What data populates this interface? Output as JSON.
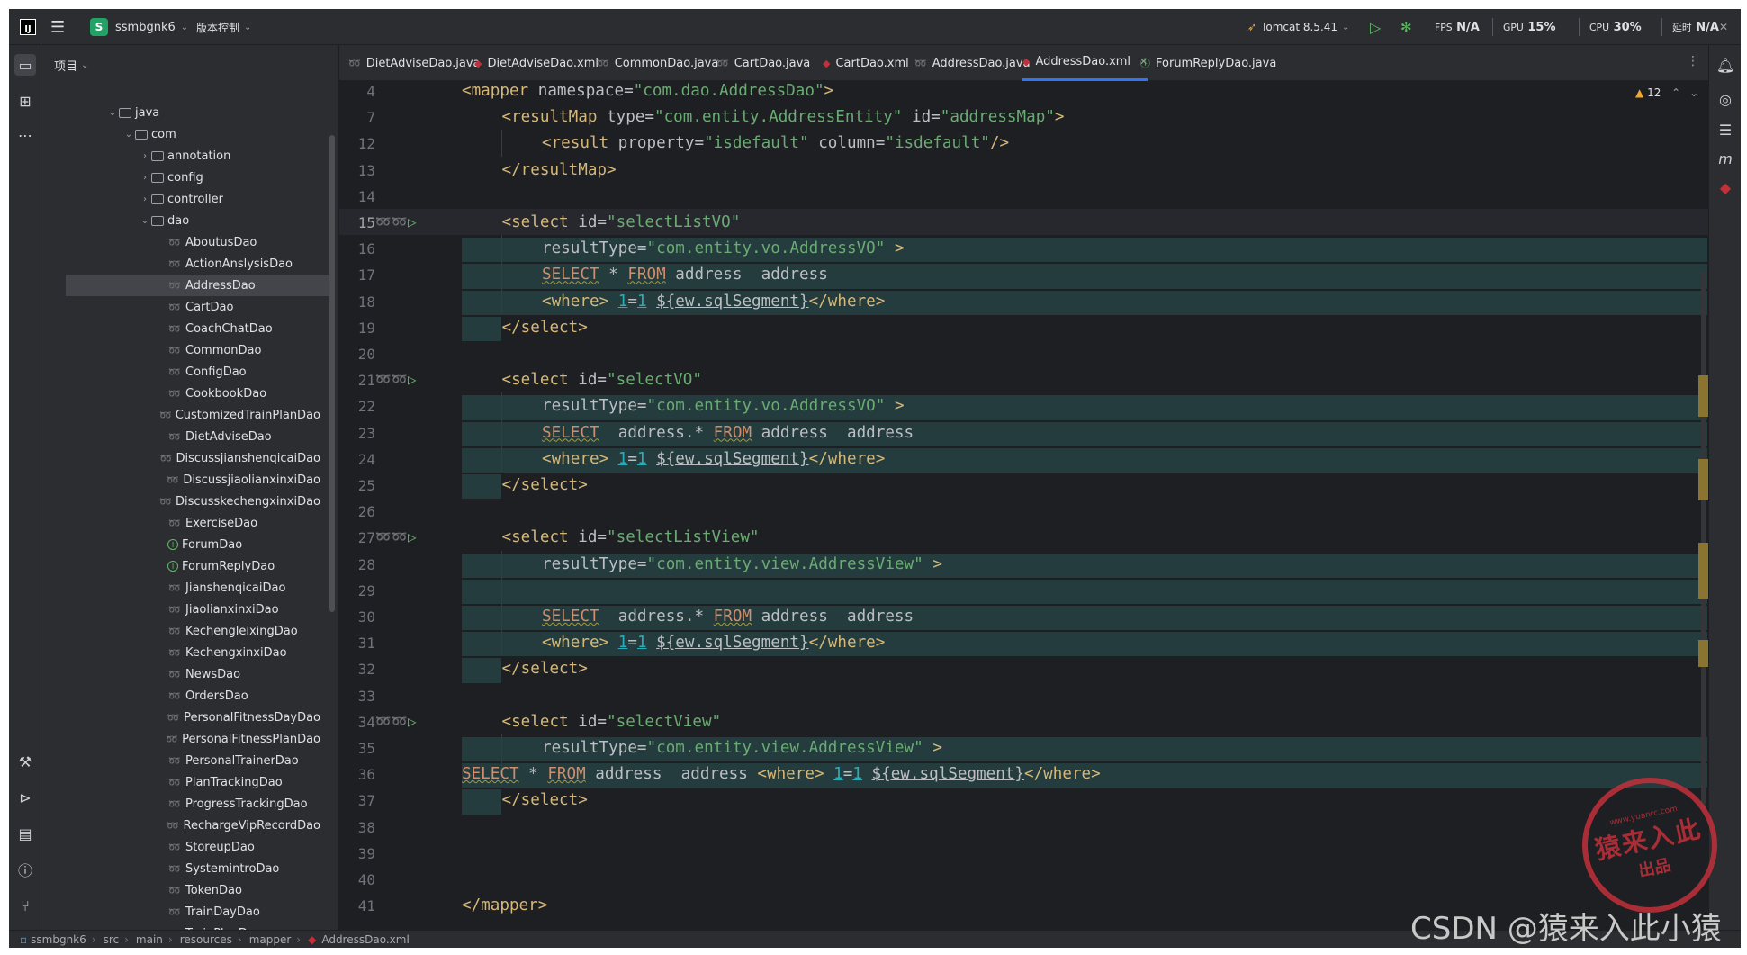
{
  "titlebar": {
    "project_badge": "S",
    "project_name": "ssmbgnk6",
    "vcs_label": "版本控制",
    "run_config": "Tomcat 8.5.41",
    "fps_label": "FPS",
    "fps_value": "N/A",
    "gpu_label": "GPU",
    "gpu_value": "15%",
    "cpu_label": "CPU",
    "cpu_value": "30%",
    "time_label": "延时",
    "time_value": "N/A"
  },
  "project_panel": {
    "title": "项目",
    "tree": [
      {
        "label": "java",
        "kind": "folder",
        "expanded": true,
        "depth": 0
      },
      {
        "label": "com",
        "kind": "folder",
        "expanded": true,
        "depth": 1
      },
      {
        "label": "annotation",
        "kind": "folder",
        "expanded": false,
        "depth": 2
      },
      {
        "label": "config",
        "kind": "folder",
        "expanded": false,
        "depth": 2
      },
      {
        "label": "controller",
        "kind": "folder",
        "expanded": false,
        "depth": 2
      },
      {
        "label": "dao",
        "kind": "folder",
        "expanded": true,
        "depth": 2
      },
      {
        "label": "AboutusDao",
        "kind": "mybatis",
        "depth": 3
      },
      {
        "label": "ActionAnslysisDao",
        "kind": "mybatis",
        "depth": 3
      },
      {
        "label": "AddressDao",
        "kind": "mybatis",
        "depth": 3,
        "selected": true
      },
      {
        "label": "CartDao",
        "kind": "mybatis",
        "depth": 3
      },
      {
        "label": "CoachChatDao",
        "kind": "mybatis",
        "depth": 3
      },
      {
        "label": "CommonDao",
        "kind": "mybatis",
        "depth": 3
      },
      {
        "label": "ConfigDao",
        "kind": "mybatis",
        "depth": 3
      },
      {
        "label": "CookbookDao",
        "kind": "mybatis",
        "depth": 3
      },
      {
        "label": "CustomizedTrainPlanDao",
        "kind": "mybatis",
        "depth": 3
      },
      {
        "label": "DietAdviseDao",
        "kind": "mybatis",
        "depth": 3
      },
      {
        "label": "DiscussjianshenqicaiDao",
        "kind": "mybatis",
        "depth": 3
      },
      {
        "label": "DiscussjiaolianxinxiDao",
        "kind": "mybatis",
        "depth": 3
      },
      {
        "label": "DiscusskechengxinxiDao",
        "kind": "mybatis",
        "depth": 3
      },
      {
        "label": "ExerciseDao",
        "kind": "mybatis",
        "depth": 3
      },
      {
        "label": "ForumDao",
        "kind": "interface",
        "depth": 3
      },
      {
        "label": "ForumReplyDao",
        "kind": "interface",
        "depth": 3
      },
      {
        "label": "JianshenqicaiDao",
        "kind": "mybatis",
        "depth": 3
      },
      {
        "label": "JiaolianxinxiDao",
        "kind": "mybatis",
        "depth": 3
      },
      {
        "label": "KechengleixingDao",
        "kind": "mybatis",
        "depth": 3
      },
      {
        "label": "KechengxinxiDao",
        "kind": "mybatis",
        "depth": 3
      },
      {
        "label": "NewsDao",
        "kind": "mybatis",
        "depth": 3
      },
      {
        "label": "OrdersDao",
        "kind": "mybatis",
        "depth": 3
      },
      {
        "label": "PersonalFitnessDayDao",
        "kind": "mybatis",
        "depth": 3
      },
      {
        "label": "PersonalFitnessPlanDao",
        "kind": "mybatis",
        "depth": 3
      },
      {
        "label": "PersonalTrainerDao",
        "kind": "mybatis",
        "depth": 3
      },
      {
        "label": "PlanTrackingDao",
        "kind": "mybatis",
        "depth": 3
      },
      {
        "label": "ProgressTrackingDao",
        "kind": "mybatis",
        "depth": 3
      },
      {
        "label": "RechargeVipRecordDao",
        "kind": "mybatis",
        "depth": 3
      },
      {
        "label": "StoreupDao",
        "kind": "mybatis",
        "depth": 3
      },
      {
        "label": "SystemintroDao",
        "kind": "mybatis",
        "depth": 3
      },
      {
        "label": "TokenDao",
        "kind": "mybatis",
        "depth": 3
      },
      {
        "label": "TrainDayDao",
        "kind": "mybatis",
        "depth": 3
      },
      {
        "label": "TrainPlanDao",
        "kind": "mybatis",
        "depth": 3
      }
    ]
  },
  "tabs": [
    {
      "label": "DietAdviseDao.java",
      "kind": "mybatis"
    },
    {
      "label": "DietAdviseDao.xml",
      "kind": "xml"
    },
    {
      "label": "CommonDao.java",
      "kind": "mybatis"
    },
    {
      "label": "CartDao.java",
      "kind": "mybatis"
    },
    {
      "label": "CartDao.xml",
      "kind": "xml"
    },
    {
      "label": "AddressDao.java",
      "kind": "mybatis"
    },
    {
      "label": "AddressDao.xml",
      "kind": "xml",
      "active": true
    },
    {
      "label": "ForumReplyDao.java",
      "kind": "interface"
    }
  ],
  "editor": {
    "warning_count": "12",
    "lines": [
      {
        "n": "4",
        "text": "<mapper namespace=\"com.dao.AddressDao\">"
      },
      {
        "n": "7",
        "text": "<resultMap type=\"com.entity.AddressEntity\" id=\"addressMap\">"
      },
      {
        "n": "12",
        "text": "<result property=\"isdefault\" column=\"isdefault\"/>"
      },
      {
        "n": "13",
        "text": "</resultMap>"
      },
      {
        "n": "14",
        "text": ""
      },
      {
        "n": "15",
        "text": "<select id=\"selectListVO\""
      },
      {
        "n": "16",
        "text": "resultType=\"com.entity.vo.AddressVO\" >"
      },
      {
        "n": "17",
        "text": "SELECT * FROM address  address"
      },
      {
        "n": "18",
        "text": "<where> 1=1 ${ew.sqlSegment}</where>"
      },
      {
        "n": "19",
        "text": "</select>"
      },
      {
        "n": "20",
        "text": ""
      },
      {
        "n": "21",
        "text": "<select id=\"selectVO\""
      },
      {
        "n": "22",
        "text": "resultType=\"com.entity.vo.AddressVO\" >"
      },
      {
        "n": "23",
        "text": "SELECT  address.* FROM address  address"
      },
      {
        "n": "24",
        "text": "<where> 1=1 ${ew.sqlSegment}</where>"
      },
      {
        "n": "25",
        "text": "</select>"
      },
      {
        "n": "26",
        "text": ""
      },
      {
        "n": "27",
        "text": "<select id=\"selectListView\""
      },
      {
        "n": "28",
        "text": "resultType=\"com.entity.view.AddressView\" >"
      },
      {
        "n": "29",
        "text": ""
      },
      {
        "n": "30",
        "text": "SELECT  address.* FROM address  address"
      },
      {
        "n": "31",
        "text": "<where> 1=1 ${ew.sqlSegment}</where>"
      },
      {
        "n": "32",
        "text": "</select>"
      },
      {
        "n": "33",
        "text": ""
      },
      {
        "n": "34",
        "text": "<select id=\"selectView\""
      },
      {
        "n": "35",
        "text": "resultType=\"com.entity.view.AddressView\" >"
      },
      {
        "n": "36",
        "text": "SELECT * FROM address  address <where> 1=1 ${ew.sqlSegment}</where>"
      },
      {
        "n": "37",
        "text": "</select>"
      },
      {
        "n": "38",
        "text": ""
      },
      {
        "n": "39",
        "text": ""
      },
      {
        "n": "40",
        "text": ""
      },
      {
        "n": "41",
        "text": "</mapper>"
      }
    ]
  },
  "status_bar": {
    "crumbs": [
      "ssmbgnk6",
      "src",
      "main",
      "resources",
      "mapper",
      "AddressDao.xml"
    ]
  },
  "watermark": {
    "stamp_top": "www.yuanrc.com",
    "stamp_main": "猿来入此",
    "stamp_sub": "出品",
    "csdn": "CSDN @猿来入此小猿"
  },
  "colors": {
    "editor_bg": "#1e1f22",
    "panel_bg": "#2b2d30",
    "accent": "#3574f0",
    "tag": "#d5b778",
    "string": "#6aab73",
    "keyword": "#cf8e6d",
    "number": "#2aacb8",
    "injection_bg": "#243c3d"
  }
}
